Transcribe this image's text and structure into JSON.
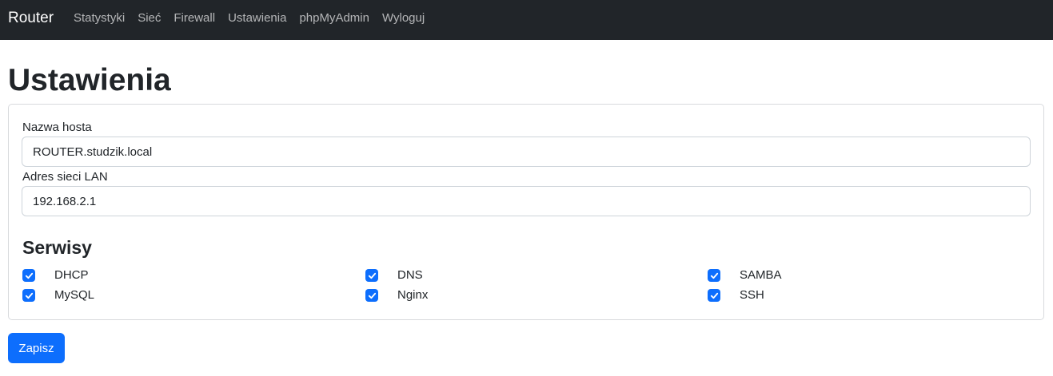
{
  "navbar": {
    "brand": "Router",
    "links": [
      "Statystyki",
      "Sieć",
      "Firewall",
      "Ustawienia",
      "phpMyAdmin",
      "Wyloguj"
    ]
  },
  "page_title": "Ustawienia",
  "form": {
    "hostname": {
      "label": "Nazwa hosta",
      "value": "ROUTER.studzik.local"
    },
    "lan_address": {
      "label": "Adres sieci LAN",
      "value": "192.168.2.1"
    },
    "services_title": "Serwisy",
    "services": [
      {
        "label": "DHCP",
        "checked": true
      },
      {
        "label": "DNS",
        "checked": true
      },
      {
        "label": "SAMBA",
        "checked": true
      },
      {
        "label": "MySQL",
        "checked": true
      },
      {
        "label": "Nginx",
        "checked": true
      },
      {
        "label": "SSH",
        "checked": true
      }
    ],
    "submit_label": "Zapisz"
  },
  "colors": {
    "navbar_bg": "#212529",
    "primary": "#0d6efd"
  }
}
